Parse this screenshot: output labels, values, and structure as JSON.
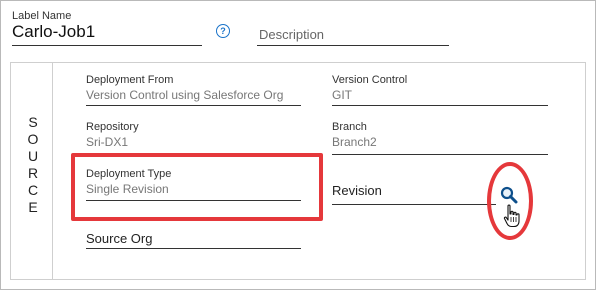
{
  "header": {
    "label_name_caption": "Label Name",
    "label_name_value": "Carlo-Job1",
    "help_glyph": "?",
    "description_placeholder": "Description"
  },
  "section": {
    "title_letters": [
      "S",
      "O",
      "U",
      "R",
      "C",
      "E"
    ]
  },
  "fields": {
    "deployment_from": {
      "label": "Deployment From",
      "value": "Version Control using Salesforce Org"
    },
    "version_control": {
      "label": "Version Control",
      "value": "GIT"
    },
    "repository": {
      "label": "Repository",
      "value": "Sri-DX1"
    },
    "branch": {
      "label": "Branch",
      "value": "Branch2"
    },
    "deployment_type": {
      "label": "Deployment Type",
      "value": "Single Revision"
    },
    "revision": {
      "label": "Revision"
    },
    "source_org": {
      "label": "Source Org"
    }
  },
  "icons": {
    "help": "help-circle-icon",
    "search": "magnifier-icon",
    "cursor": "hand-pointer-icon"
  },
  "colors": {
    "accent": "#1a73c9",
    "highlight": "#e5383b"
  }
}
